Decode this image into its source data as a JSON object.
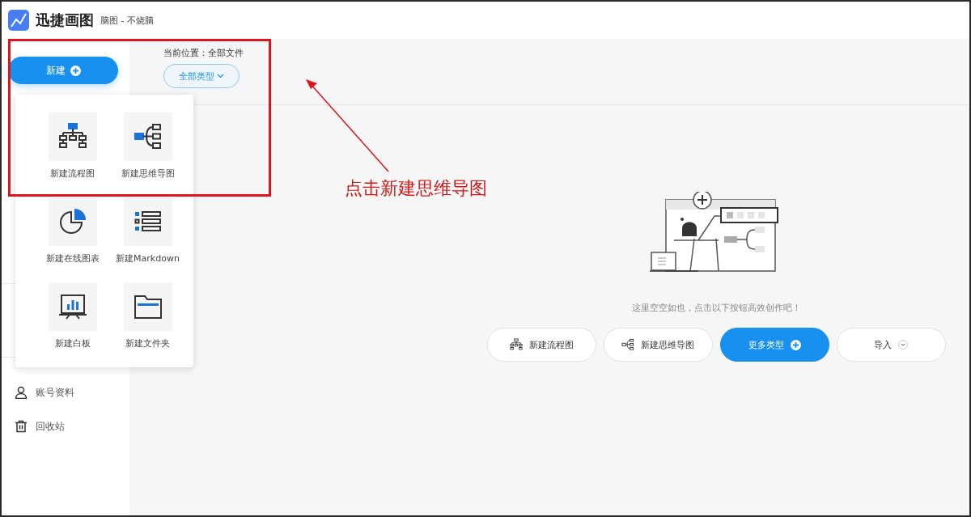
{
  "app": {
    "name": "迅捷画图",
    "subtitle": "脑图 - 不烧脑"
  },
  "sidebar": {
    "new_button": "新建",
    "items": [
      {
        "label": "账号资料",
        "kind": "user"
      },
      {
        "label": "回收站",
        "kind": "trash"
      }
    ]
  },
  "new_menu": {
    "items": [
      {
        "label": "新建流程图",
        "kind": "flowchart"
      },
      {
        "label": "新建思维导图",
        "kind": "mindmap"
      },
      {
        "label": "新建在线图表",
        "kind": "pie"
      },
      {
        "label": "新建Markdown",
        "kind": "list"
      },
      {
        "label": "新建白板",
        "kind": "board"
      },
      {
        "label": "新建文件夹",
        "kind": "folder"
      }
    ]
  },
  "location": "当前位置：全部文件",
  "filter": "全部类型",
  "empty_state": {
    "message": "这里空空如也，点击以下按钮高效创作吧！",
    "buttons": [
      {
        "label": "新建流程图",
        "kind": "flowchart"
      },
      {
        "label": "新建思维导图",
        "kind": "mindmap"
      },
      {
        "label": "更多类型",
        "kind": "more"
      },
      {
        "label": "导入",
        "kind": "import"
      }
    ]
  },
  "annotation": {
    "text": "点击新建思维导图"
  }
}
